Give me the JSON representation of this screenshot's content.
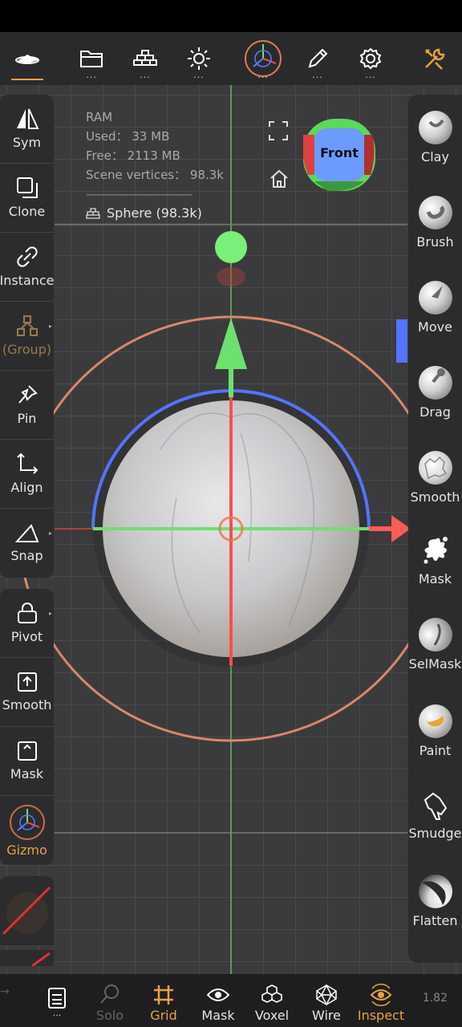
{
  "topbar": {
    "items": [
      {
        "name": "scene-icon",
        "dots": ""
      },
      {
        "name": "files-icon",
        "dots": "..."
      },
      {
        "name": "scene-list-icon",
        "dots": "..."
      },
      {
        "name": "light-icon",
        "dots": "..."
      },
      {
        "name": "gizmo-icon",
        "dots": "..."
      },
      {
        "name": "brush-icon",
        "dots": "..."
      },
      {
        "name": "settings-icon",
        "dots": "..."
      },
      {
        "name": "tools-icon",
        "dots": ""
      }
    ]
  },
  "info": {
    "ram": "RAM",
    "used": "Used： 33 MB",
    "free": "Free： 2113 MB",
    "vertices": "Scene vertices： 98.3k",
    "separator": "------------------------------",
    "object": "Sphere (98.3k)"
  },
  "view_cube": {
    "label": "Front"
  },
  "left_tools": [
    {
      "label": "Sym"
    },
    {
      "label": "Clone"
    },
    {
      "label": "Instance"
    },
    {
      "label": "(Group)"
    },
    {
      "label": "Pin"
    },
    {
      "label": "Align"
    },
    {
      "label": "Snap"
    },
    {
      "label": "Pivot"
    },
    {
      "label": "Smooth"
    },
    {
      "label": "Mask"
    },
    {
      "label": "Gizmo"
    }
  ],
  "right_tools": [
    {
      "label": "Clay"
    },
    {
      "label": "Brush"
    },
    {
      "label": "Move"
    },
    {
      "label": "Drag"
    },
    {
      "label": "Smooth"
    },
    {
      "label": "Mask"
    },
    {
      "label": "SelMask"
    },
    {
      "label": "Paint"
    },
    {
      "label": "Smudge"
    },
    {
      "label": "Flatten"
    }
  ],
  "bottom": {
    "layers_dots": "...",
    "solo": "Solo",
    "grid": "Grid",
    "mask": "Mask",
    "voxel": "Voxel",
    "wire": "Wire",
    "inspect": "Inspect",
    "zoom": "1.82"
  },
  "colors": {
    "accent": "#e8a33c",
    "panel": "#2c2c2e",
    "viewport": "#3b3b3d"
  }
}
